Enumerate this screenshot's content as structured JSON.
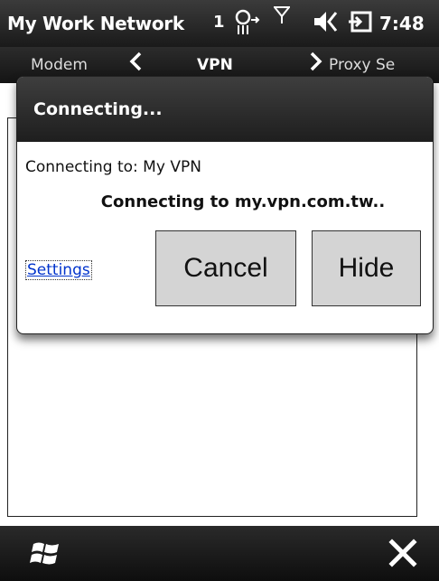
{
  "status_bar": {
    "title": "My Work Network",
    "connection_count": "1",
    "icons": [
      "network-connectivity-icon",
      "signal-strength-icon",
      "volume-muted-icon",
      "battery-charging-icon"
    ],
    "time": "7:48"
  },
  "tabs": [
    {
      "label": "Modem"
    },
    {
      "label": "VPN",
      "active": true
    },
    {
      "label": "Proxy Se"
    }
  ],
  "dialog": {
    "title": "Connecting...",
    "connecting_to": "Connecting to: My VPN",
    "message": "Connecting to my.vpn.com.tw..",
    "settings_link": "Settings",
    "cancel_label": "Cancel",
    "hide_label": "Hide"
  },
  "bottom_bar": {
    "icons": [
      "windows-start-icon",
      "close-icon"
    ]
  }
}
